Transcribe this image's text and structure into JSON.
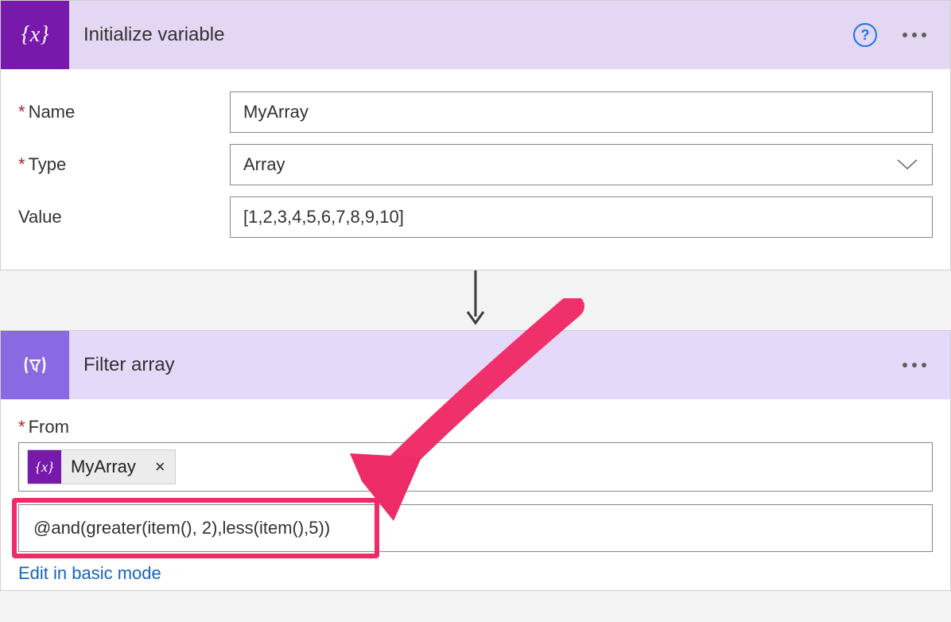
{
  "card1": {
    "title": "Initialize variable",
    "fields": {
      "name": {
        "label": "Name",
        "value": "MyArray",
        "required": true
      },
      "type": {
        "label": "Type",
        "value": "Array",
        "required": true
      },
      "value": {
        "label": "Value",
        "value": "[1,2,3,4,5,6,7,8,9,10]",
        "required": false
      }
    }
  },
  "card2": {
    "title": "Filter array",
    "from": {
      "label": "From",
      "required": true,
      "token": "MyArray"
    },
    "expression": "@and(greater(item(), 2),less(item(),5))",
    "editLink": "Edit in basic mode"
  }
}
